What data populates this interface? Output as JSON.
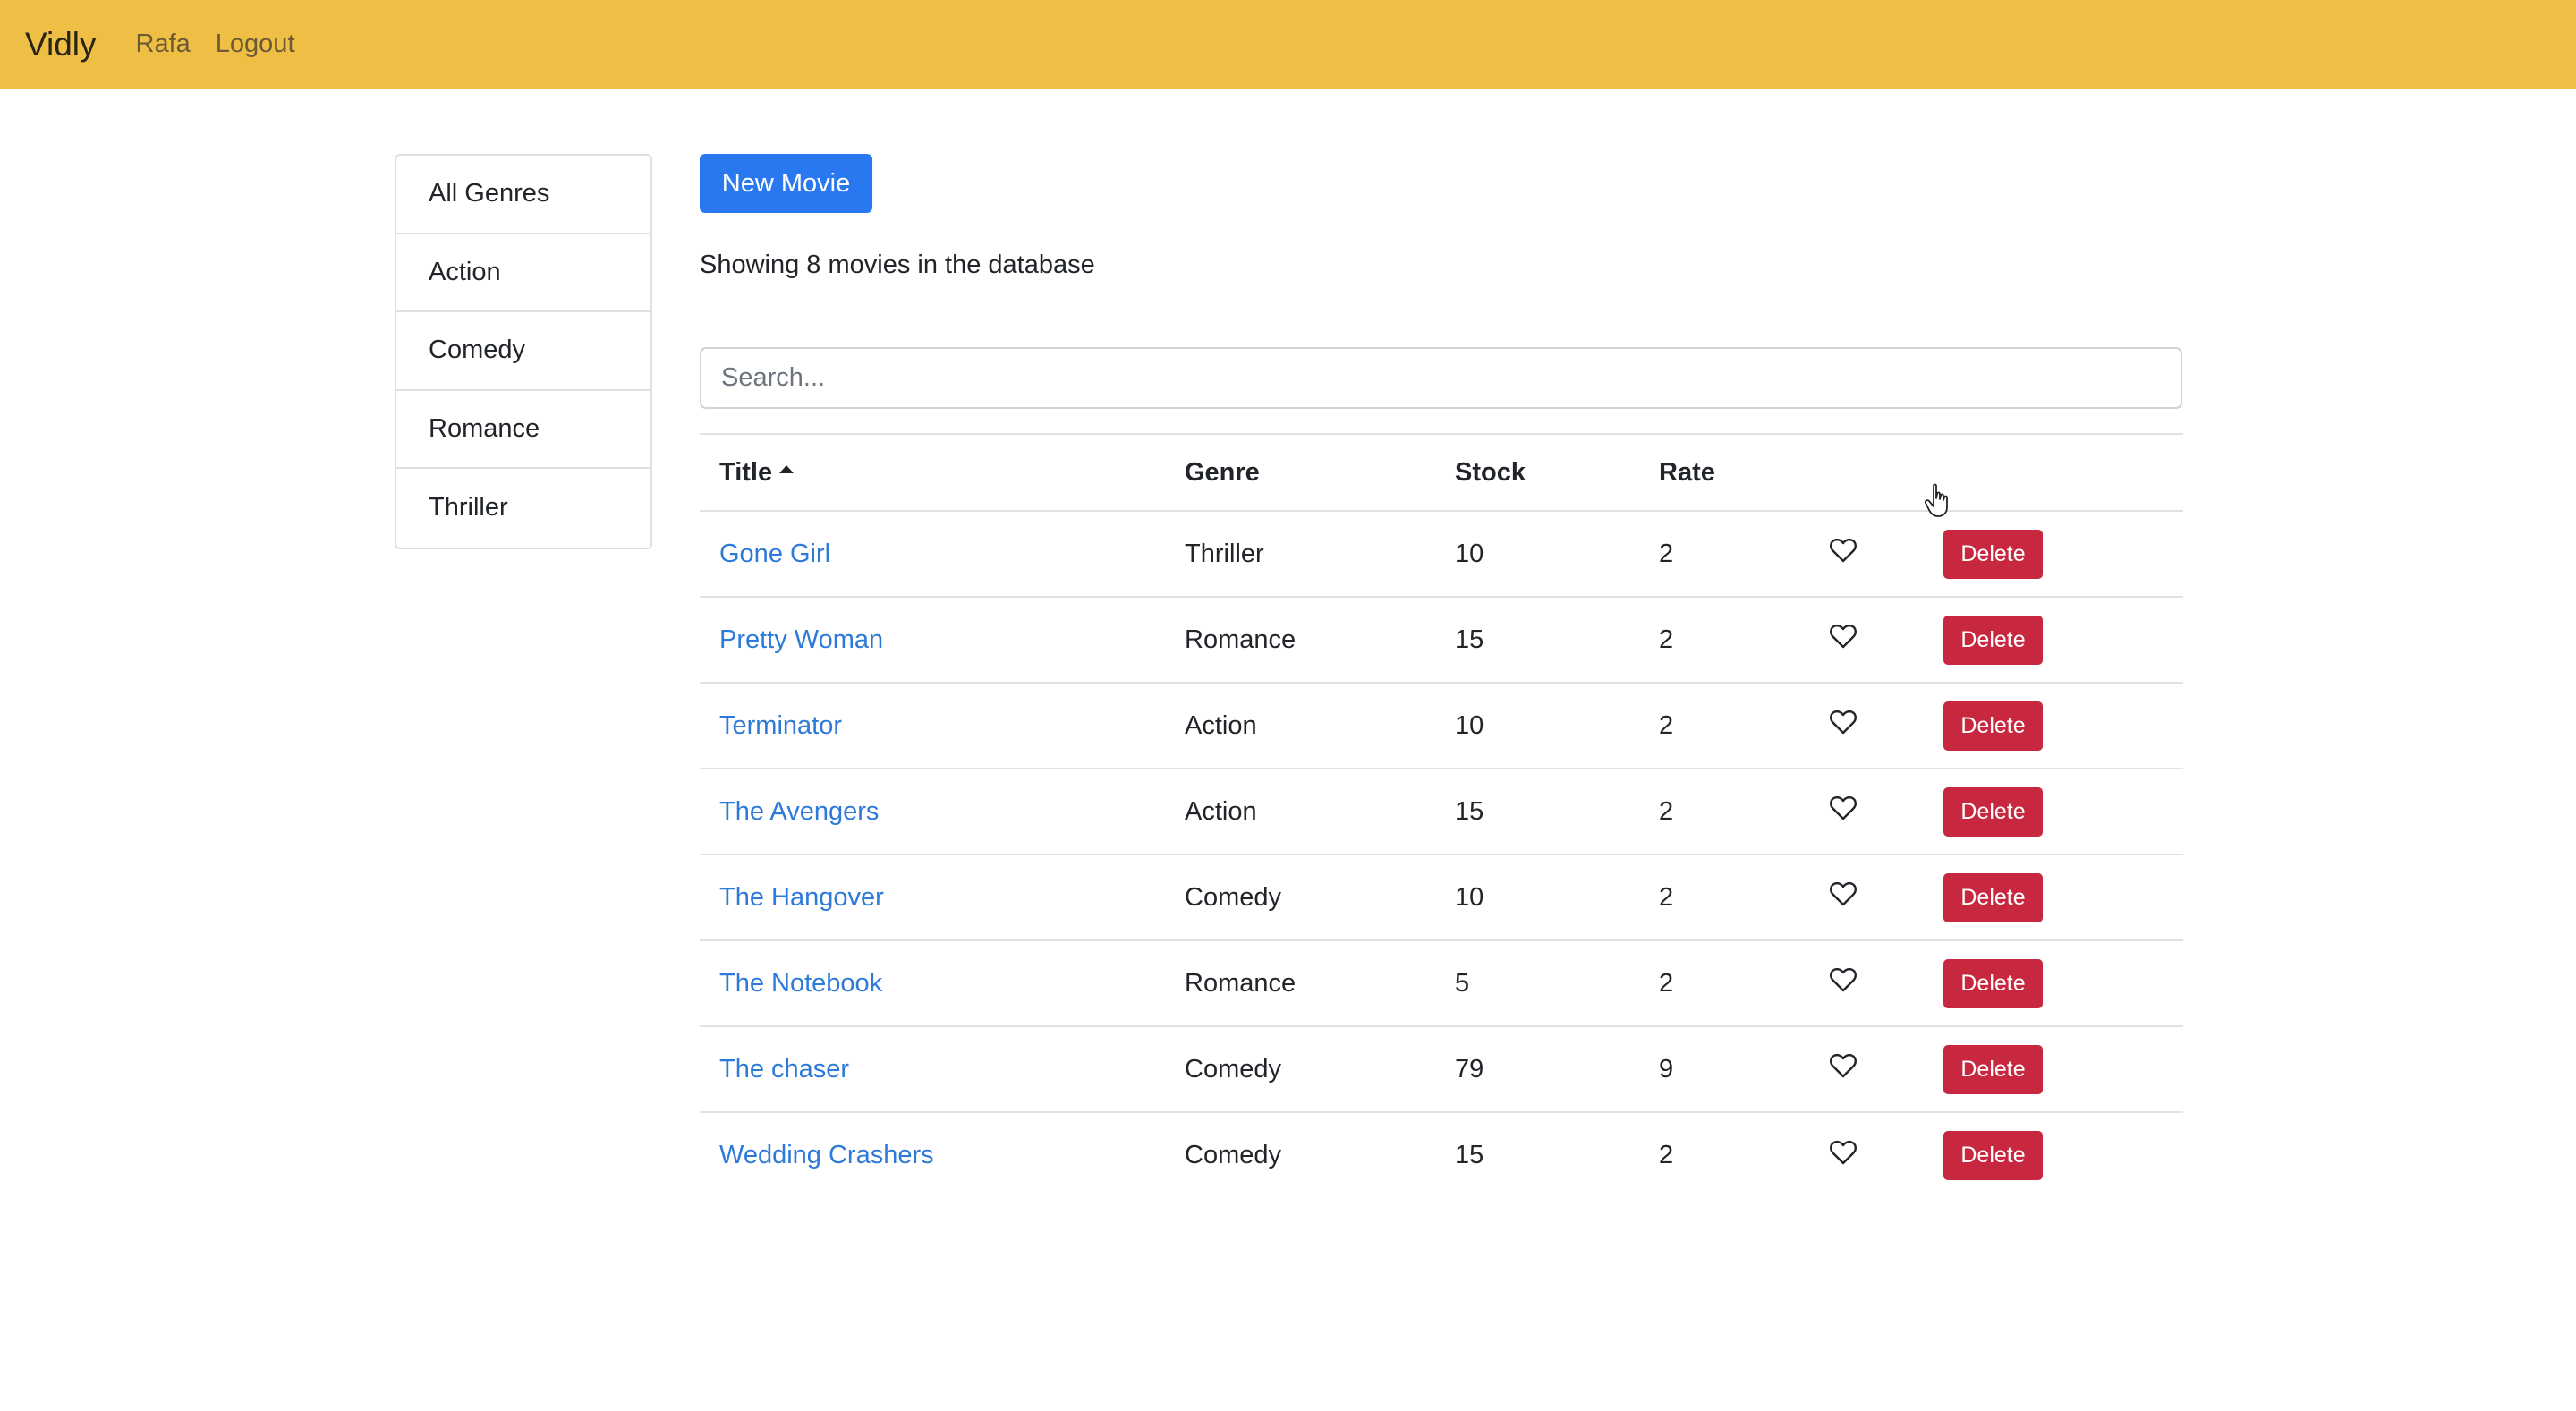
{
  "navbar": {
    "brand": "Vidly",
    "links": [
      "Rafa",
      "Logout"
    ]
  },
  "genres": [
    "All Genres",
    "Action",
    "Comedy",
    "Romance",
    "Thriller"
  ],
  "main": {
    "new_movie_label": "New Movie",
    "count_text": "Showing 8 movies in the database",
    "search_placeholder": "Search..."
  },
  "table": {
    "headers": {
      "title": "Title",
      "genre": "Genre",
      "stock": "Stock",
      "rate": "Rate"
    },
    "sort_column": "Title",
    "sort_order": "ascending",
    "delete_label": "Delete",
    "rows": [
      {
        "title": "Gone Girl",
        "genre": "Thriller",
        "stock": "10",
        "rate": "2"
      },
      {
        "title": "Pretty Woman",
        "genre": "Romance",
        "stock": "15",
        "rate": "2"
      },
      {
        "title": "Terminator",
        "genre": "Action",
        "stock": "10",
        "rate": "2"
      },
      {
        "title": "The Avengers",
        "genre": "Action",
        "stock": "15",
        "rate": "2"
      },
      {
        "title": "The Hangover",
        "genre": "Comedy",
        "stock": "10",
        "rate": "2"
      },
      {
        "title": "The Notebook",
        "genre": "Romance",
        "stock": "5",
        "rate": "2"
      },
      {
        "title": "The chaser",
        "genre": "Comedy",
        "stock": "79",
        "rate": "9"
      },
      {
        "title": "Wedding Crashers",
        "genre": "Comedy",
        "stock": "15",
        "rate": "2"
      }
    ]
  },
  "colors": {
    "navbar": "#efbf45",
    "primary": "#2a78f0",
    "danger": "#c8283f",
    "link": "#2d7ad8"
  },
  "icons": {
    "like": "heart-outline-icon",
    "sort": "caret-up-icon",
    "cursor": "hand-pointer-icon"
  }
}
